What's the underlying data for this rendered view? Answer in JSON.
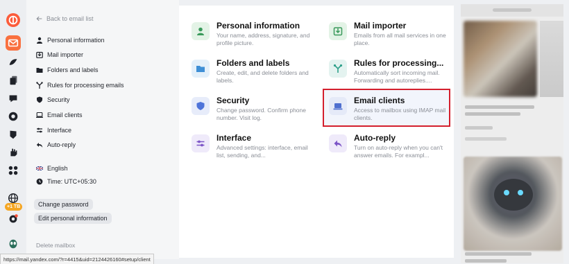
{
  "rail": {
    "icons": [
      "yandex-logo-icon",
      "mail-icon",
      "disk-icon",
      "documents-icon",
      "messenger-icon",
      "shield-icon",
      "hand-icon",
      "apps-icon",
      "globe-icon",
      "settings-icon",
      "alien-icon"
    ],
    "storage_badge": "+1 TB"
  },
  "menu": {
    "back_label": "Back to email list",
    "items": [
      {
        "label": "Personal information",
        "icon": "person-icon"
      },
      {
        "label": "Mail importer",
        "icon": "import-icon"
      },
      {
        "label": "Folders and labels",
        "icon": "folder-icon"
      },
      {
        "label": "Rules for processing emails",
        "icon": "rules-icon"
      },
      {
        "label": "Security",
        "icon": "shield-icon"
      },
      {
        "label": "Email clients",
        "icon": "laptop-icon"
      },
      {
        "label": "Interface",
        "icon": "sliders-icon"
      },
      {
        "label": "Auto-reply",
        "icon": "reply-icon"
      }
    ],
    "language": "English",
    "time": "Time: UTC+05:30",
    "change_password": "Change password",
    "edit_personal": "Edit personal information",
    "delete_mailbox": "Delete mailbox"
  },
  "cards": [
    {
      "title": "Personal information",
      "desc": "Your name, address, signature, and profile picture.",
      "icon": "person-icon",
      "tile_color": "#e3f3e6",
      "icon_color": "#3a9a5b"
    },
    {
      "title": "Mail importer",
      "desc": "Emails from all mail services in one place.",
      "icon": "import-icon",
      "tile_color": "#e3f3e6",
      "icon_color": "#3a9a5b"
    },
    {
      "title": "Folders and labels",
      "desc": "Create, edit, and delete folders and labels.",
      "icon": "folder-icon",
      "tile_color": "#e4f0fa",
      "icon_color": "#3f8fd6"
    },
    {
      "title": "Rules for processing...",
      "desc": "Automatically sort incoming mail. Forwarding and autoreplies....",
      "icon": "rules-icon",
      "tile_color": "#e4f3f0",
      "icon_color": "#2ea08a"
    },
    {
      "title": "Security",
      "desc": "Change password. Confirm phone number. Visit log.",
      "icon": "shield-icon",
      "tile_color": "#e7ecfa",
      "icon_color": "#4f74d9"
    },
    {
      "title": "Email clients",
      "desc": "Access to mailbox using IMAP mail clients.",
      "icon": "laptop-icon",
      "tile_color": "#e5eaf8",
      "icon_color": "#4f6fcf"
    },
    {
      "title": "Interface",
      "desc": "Advanced settings: interface, email list, sending, and...",
      "icon": "sliders-icon",
      "tile_color": "#efeafa",
      "icon_color": "#7d55c7"
    },
    {
      "title": "Auto-reply",
      "desc": "Turn on auto-reply when you can't answer emails. For exampl...",
      "icon": "reply-icon",
      "tile_color": "#efeafa",
      "icon_color": "#7d55c7"
    }
  ],
  "status_url": "https://mail.yandex.com/?r=4415&uid=2124426160#setup/client",
  "colors": {
    "accent_orange": "#fc5c3b",
    "highlight_border": "#d41f2d"
  }
}
